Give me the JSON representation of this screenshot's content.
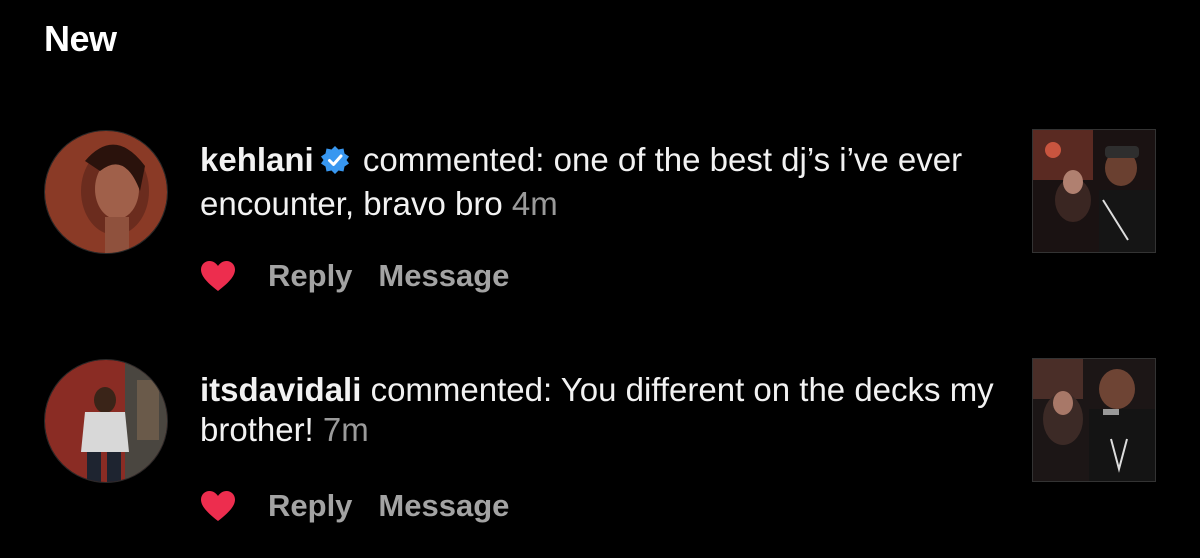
{
  "section": {
    "title": "New"
  },
  "notifications": [
    {
      "username": "kehlani",
      "verified": true,
      "action": "commented:",
      "comment": "one of the best dj’s i’ve ever encounter, bravo bro",
      "time": "4m",
      "liked": true,
      "reply_label": "Reply",
      "message_label": "Message"
    },
    {
      "username": "itsdavidali",
      "verified": false,
      "action": "commented:",
      "comment": "You different on the decks my brother!",
      "time": "7m",
      "liked": true,
      "reply_label": "Reply",
      "message_label": "Message"
    }
  ],
  "colors": {
    "heart": "#ed2d4e",
    "verified": "#3897f0",
    "muted": "#9a9a9a",
    "background": "#000000"
  }
}
